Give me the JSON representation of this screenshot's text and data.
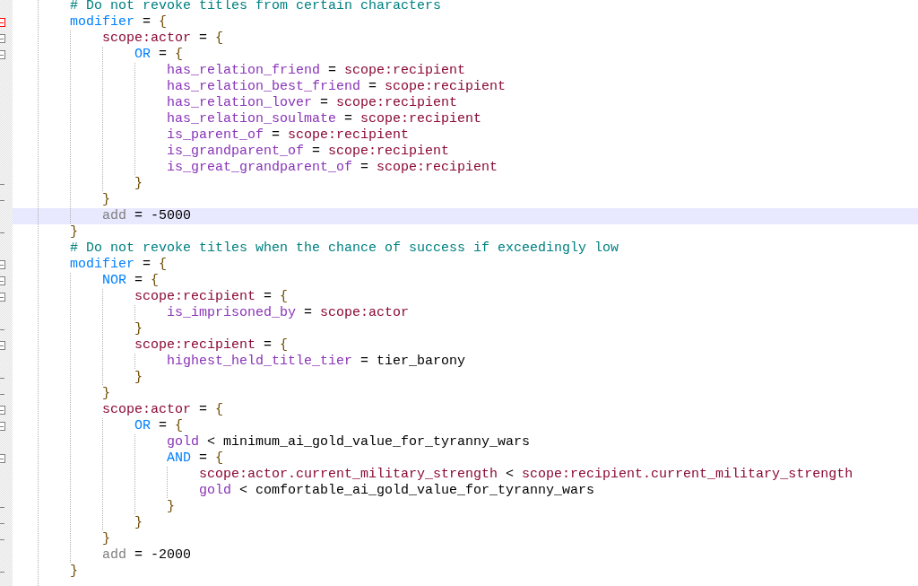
{
  "editor": {
    "lines": [
      {
        "kind": "plain",
        "current": false,
        "tokens": [
          {
            "kind": "comment",
            "text": "# Do not revoke titles from certain characters"
          }
        ]
      },
      {
        "kind": "fold_start_current",
        "current": false,
        "tokens": [
          {
            "kind": "keyword",
            "text": "modifier"
          },
          {
            "kind": "operator",
            "text": " = "
          },
          {
            "kind": "brace",
            "text": "{"
          }
        ],
        "children": [
          {
            "kind": "fold_start",
            "current": false,
            "tokens": [
              {
                "kind": "scope",
                "text": "scope:actor"
              },
              {
                "kind": "operator",
                "text": " = "
              },
              {
                "kind": "brace",
                "text": "{"
              }
            ],
            "children": [
              {
                "kind": "fold_start",
                "current": false,
                "tokens": [
                  {
                    "kind": "keyword",
                    "text": "OR"
                  },
                  {
                    "kind": "operator",
                    "text": " = "
                  },
                  {
                    "kind": "brace",
                    "text": "{"
                  }
                ],
                "children": [
                  {
                    "kind": "plain",
                    "current": false,
                    "tokens": [
                      {
                        "kind": "trigger",
                        "text": "has_relation_friend"
                      },
                      {
                        "kind": "operator",
                        "text": " = "
                      },
                      {
                        "kind": "scope",
                        "text": "scope:recipient"
                      }
                    ]
                  },
                  {
                    "kind": "plain",
                    "current": false,
                    "tokens": [
                      {
                        "kind": "trigger",
                        "text": "has_relation_best_friend"
                      },
                      {
                        "kind": "operator",
                        "text": " = "
                      },
                      {
                        "kind": "scope",
                        "text": "scope:recipient"
                      }
                    ]
                  },
                  {
                    "kind": "plain",
                    "current": false,
                    "tokens": [
                      {
                        "kind": "trigger",
                        "text": "has_relation_lover"
                      },
                      {
                        "kind": "operator",
                        "text": " = "
                      },
                      {
                        "kind": "scope",
                        "text": "scope:recipient"
                      }
                    ]
                  },
                  {
                    "kind": "plain",
                    "current": false,
                    "tokens": [
                      {
                        "kind": "trigger",
                        "text": "has_relation_soulmate"
                      },
                      {
                        "kind": "operator",
                        "text": " = "
                      },
                      {
                        "kind": "scope",
                        "text": "scope:recipient"
                      }
                    ]
                  },
                  {
                    "kind": "plain",
                    "current": false,
                    "tokens": [
                      {
                        "kind": "trigger",
                        "text": "is_parent_of"
                      },
                      {
                        "kind": "operator",
                        "text": " = "
                      },
                      {
                        "kind": "scope",
                        "text": "scope:recipient"
                      }
                    ]
                  },
                  {
                    "kind": "plain",
                    "current": false,
                    "tokens": [
                      {
                        "kind": "trigger",
                        "text": "is_grandparent_of"
                      },
                      {
                        "kind": "operator",
                        "text": " = "
                      },
                      {
                        "kind": "scope",
                        "text": "scope:recipient"
                      }
                    ]
                  },
                  {
                    "kind": "plain",
                    "current": false,
                    "tokens": [
                      {
                        "kind": "trigger",
                        "text": "is_great_grandparent_of"
                      },
                      {
                        "kind": "operator",
                        "text": " = "
                      },
                      {
                        "kind": "scope",
                        "text": "scope:recipient"
                      }
                    ]
                  }
                ],
                "end": {
                  "kind": "fold_end",
                  "current": false,
                  "tokens": [
                    {
                      "kind": "brace",
                      "text": "}"
                    }
                  ]
                }
              }
            ],
            "end": {
              "kind": "fold_end",
              "current": false,
              "tokens": [
                {
                  "kind": "brace",
                  "text": "}"
                }
              ]
            }
          },
          {
            "kind": "plain",
            "current": true,
            "tokens": [
              {
                "kind": "add",
                "text": "add"
              },
              {
                "kind": "operator",
                "text": " = "
              },
              {
                "kind": "value",
                "text": "-5000"
              }
            ]
          }
        ],
        "end": {
          "kind": "fold_end",
          "current": false,
          "tokens": [
            {
              "kind": "brace",
              "text": "}"
            }
          ]
        }
      },
      {
        "kind": "plain",
        "current": false,
        "tokens": [
          {
            "kind": "comment",
            "text": "# Do not revoke titles when the chance of success if exceedingly low"
          }
        ]
      },
      {
        "kind": "fold_start",
        "current": false,
        "tokens": [
          {
            "kind": "keyword",
            "text": "modifier"
          },
          {
            "kind": "operator",
            "text": " = "
          },
          {
            "kind": "brace",
            "text": "{"
          }
        ],
        "children": [
          {
            "kind": "fold_start",
            "current": false,
            "tokens": [
              {
                "kind": "keyword",
                "text": "NOR"
              },
              {
                "kind": "operator",
                "text": " = "
              },
              {
                "kind": "brace",
                "text": "{"
              }
            ],
            "children": [
              {
                "kind": "fold_start",
                "current": false,
                "tokens": [
                  {
                    "kind": "scope",
                    "text": "scope:recipient"
                  },
                  {
                    "kind": "operator",
                    "text": " = "
                  },
                  {
                    "kind": "brace",
                    "text": "{"
                  }
                ],
                "children": [
                  {
                    "kind": "plain",
                    "current": false,
                    "tokens": [
                      {
                        "kind": "trigger",
                        "text": "is_imprisoned_by"
                      },
                      {
                        "kind": "operator",
                        "text": " = "
                      },
                      {
                        "kind": "scope",
                        "text": "scope:actor"
                      }
                    ]
                  }
                ],
                "end": {
                  "kind": "fold_end",
                  "current": false,
                  "tokens": [
                    {
                      "kind": "brace",
                      "text": "}"
                    }
                  ]
                }
              },
              {
                "kind": "fold_start",
                "current": false,
                "tokens": [
                  {
                    "kind": "scope",
                    "text": "scope:recipient"
                  },
                  {
                    "kind": "operator",
                    "text": " = "
                  },
                  {
                    "kind": "brace",
                    "text": "{"
                  }
                ],
                "children": [
                  {
                    "kind": "plain",
                    "current": false,
                    "tokens": [
                      {
                        "kind": "trigger",
                        "text": "highest_held_title_tier"
                      },
                      {
                        "kind": "operator",
                        "text": " = "
                      },
                      {
                        "kind": "value",
                        "text": "tier_barony"
                      }
                    ]
                  }
                ],
                "end": {
                  "kind": "fold_end",
                  "current": false,
                  "tokens": [
                    {
                      "kind": "brace",
                      "text": "}"
                    }
                  ]
                }
              }
            ],
            "end": {
              "kind": "fold_end",
              "current": false,
              "tokens": [
                {
                  "kind": "brace",
                  "text": "}"
                }
              ]
            }
          },
          {
            "kind": "fold_start",
            "current": false,
            "tokens": [
              {
                "kind": "scope",
                "text": "scope:actor"
              },
              {
                "kind": "operator",
                "text": " = "
              },
              {
                "kind": "brace",
                "text": "{"
              }
            ],
            "children": [
              {
                "kind": "fold_start",
                "current": false,
                "tokens": [
                  {
                    "kind": "keyword",
                    "text": "OR"
                  },
                  {
                    "kind": "operator",
                    "text": " = "
                  },
                  {
                    "kind": "brace",
                    "text": "{"
                  }
                ],
                "children": [
                  {
                    "kind": "plain",
                    "current": false,
                    "tokens": [
                      {
                        "kind": "trigger",
                        "text": "gold"
                      },
                      {
                        "kind": "operator",
                        "text": " < "
                      },
                      {
                        "kind": "value",
                        "text": "minimum_ai_gold_value_for_tyranny_wars"
                      }
                    ]
                  },
                  {
                    "kind": "fold_start",
                    "current": false,
                    "tokens": [
                      {
                        "kind": "keyword",
                        "text": "AND"
                      },
                      {
                        "kind": "operator",
                        "text": " = "
                      },
                      {
                        "kind": "brace",
                        "text": "{"
                      }
                    ],
                    "children": [
                      {
                        "kind": "plain",
                        "current": false,
                        "tokens": [
                          {
                            "kind": "scope",
                            "text": "scope:actor.current_military_strength"
                          },
                          {
                            "kind": "operator",
                            "text": " < "
                          },
                          {
                            "kind": "scope",
                            "text": "scope:recipient.current_military_strength"
                          }
                        ]
                      },
                      {
                        "kind": "plain",
                        "current": false,
                        "tokens": [
                          {
                            "kind": "trigger",
                            "text": "gold"
                          },
                          {
                            "kind": "operator",
                            "text": " < "
                          },
                          {
                            "kind": "value",
                            "text": "comfortable_ai_gold_value_for_tyranny_wars"
                          }
                        ]
                      }
                    ],
                    "end": {
                      "kind": "fold_end",
                      "current": false,
                      "tokens": [
                        {
                          "kind": "brace",
                          "text": "}"
                        }
                      ]
                    }
                  }
                ],
                "end": {
                  "kind": "fold_end",
                  "current": false,
                  "tokens": [
                    {
                      "kind": "brace",
                      "text": "}"
                    }
                  ]
                }
              }
            ],
            "end": {
              "kind": "fold_end",
              "current": false,
              "tokens": [
                {
                  "kind": "brace",
                  "text": "}"
                }
              ]
            }
          },
          {
            "kind": "plain",
            "current": false,
            "tokens": [
              {
                "kind": "add",
                "text": "add"
              },
              {
                "kind": "operator",
                "text": " = "
              },
              {
                "kind": "value",
                "text": "-2000"
              }
            ]
          }
        ],
        "end": {
          "kind": "fold_end",
          "current": false,
          "tokens": [
            {
              "kind": "brace",
              "text": "}"
            }
          ]
        }
      }
    ]
  }
}
